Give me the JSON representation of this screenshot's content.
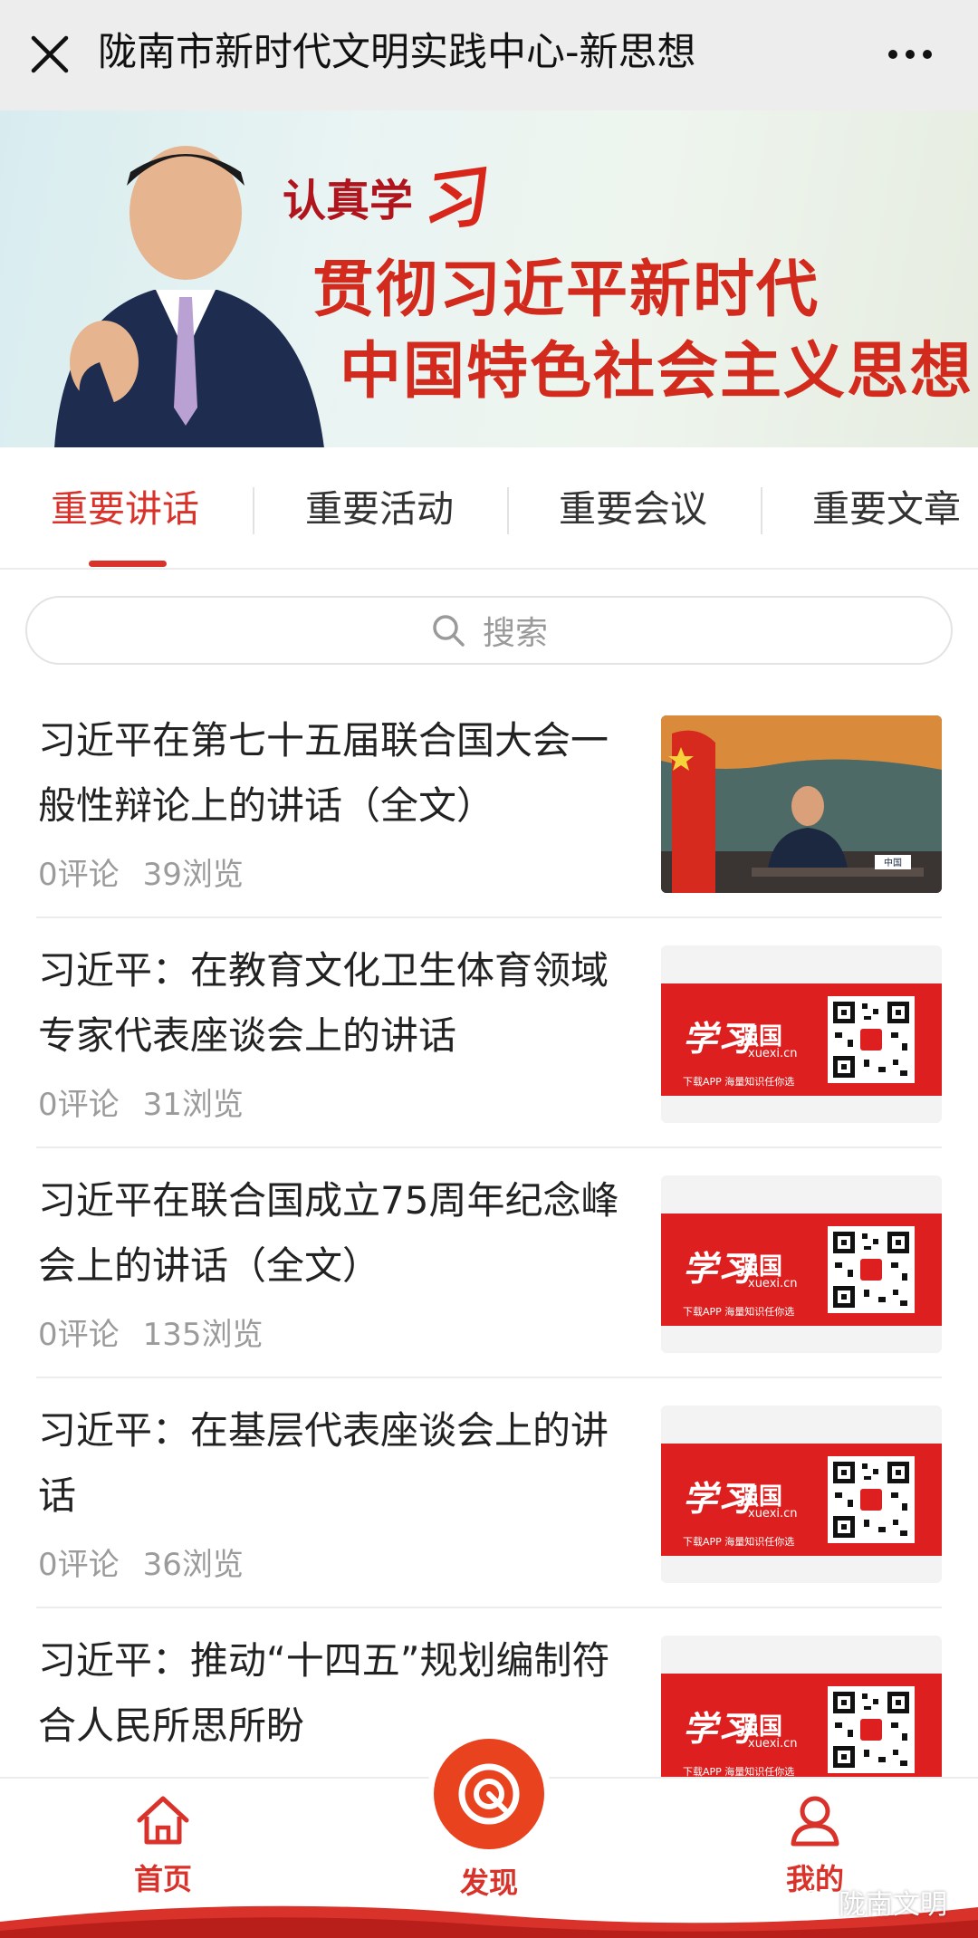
{
  "header": {
    "title": "陇南市新时代文明实践中心-新思想"
  },
  "banner": {
    "kicker": "认真学",
    "kicker_script": "习",
    "line1": "贯彻习近平新时代",
    "line2": "中国特色社会主义思想"
  },
  "tabs": [
    {
      "label": "重要讲话",
      "active": true
    },
    {
      "label": "重要活动",
      "active": false
    },
    {
      "label": "重要会议",
      "active": false
    },
    {
      "label": "重要文章",
      "active": false
    }
  ],
  "search": {
    "placeholder": "搜索"
  },
  "articles": [
    {
      "title": "习近平在第七十五届联合国大会一般性辩论上的讲话（全文）",
      "comments": "0评论",
      "views": "39浏览",
      "thumb": "un-assembly-photo"
    },
    {
      "title": "习近平：在教育文化卫生体育领域专家代表座谈会上的讲话",
      "comments": "0评论",
      "views": "31浏览",
      "thumb": "xuexi-card"
    },
    {
      "title": "习近平在联合国成立75周年纪念峰会上的讲话（全文）",
      "comments": "0评论",
      "views": "135浏览",
      "thumb": "xuexi-card"
    },
    {
      "title": "习近平：在基层代表座谈会上的讲话",
      "comments": "0评论",
      "views": "36浏览",
      "thumb": "xuexi-card"
    },
    {
      "title": "习近平：推动“十四五”规划编制符合人民所思所盼",
      "comments": "",
      "views": "",
      "thumb": "xuexi-card"
    }
  ],
  "xuexi_card": {
    "logo_script": "学习",
    "logo_text": "强国",
    "domain": "xuexi.cn",
    "note": "下载APP 海量知识任你选"
  },
  "un_photo": {
    "nameplate": "中国"
  },
  "bottom_nav": {
    "home": "首页",
    "discover": "发现",
    "mine": "我的"
  },
  "watermark": "陇南文明",
  "colors": {
    "accent": "#d8322a",
    "xuexi_red": "#dd1f1f",
    "discover_orange": "#e8421f"
  }
}
